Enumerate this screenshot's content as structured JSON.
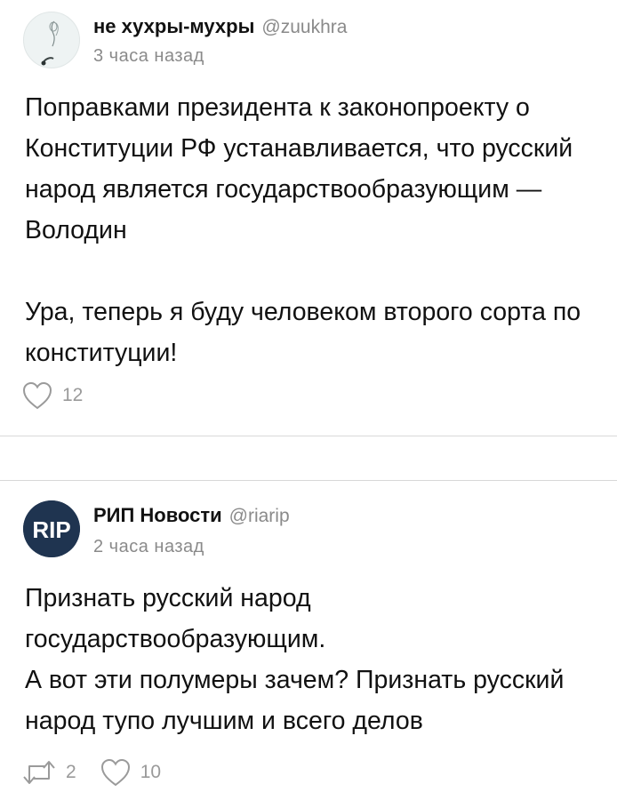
{
  "posts": [
    {
      "author": "не хухры-мухры",
      "handle": "@zuukhra",
      "time": "3 часа назад",
      "text": "Поправками президента к законопроекту о Конституции РФ устанавливается, что русский народ является государствообразующим — Володин\n\nУра, теперь я буду человеком второго сорта по конституции!",
      "likes": "12",
      "avatar_icon": "sketch-avatar-icon"
    },
    {
      "author": "РИП Новости",
      "handle": "@riarip",
      "time": "2 часа назад",
      "text": "Признать русский народ государствообразующим.\nА вот эти полумеры зачем? Признать русский народ тупо лучшим и всего делов",
      "reposts": "2",
      "likes": "10",
      "avatar_text": "RIP",
      "avatar_color": "#1f3450"
    }
  ],
  "colors": {
    "text": "#111111",
    "muted": "#8a8a8a",
    "icon": "#9a9a9a",
    "divider": "#d8d8d8"
  }
}
